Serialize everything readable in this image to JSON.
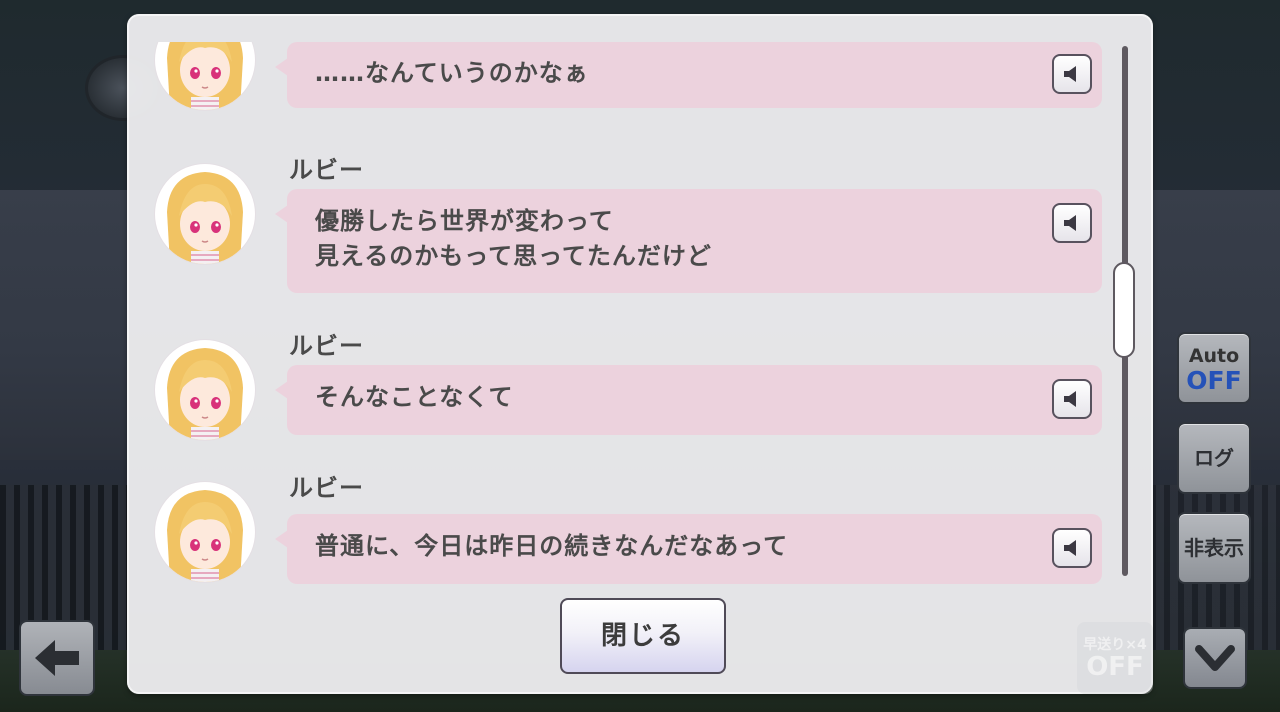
{
  "log": {
    "entries": [
      {
        "speaker": "",
        "text": "……なんていうのかなぁ"
      },
      {
        "speaker": "ルビー",
        "text": "優勝したら世界が変わって\n見えるのかもって思ってたんだけど"
      },
      {
        "speaker": "ルビー",
        "text": "そんなことなくて"
      },
      {
        "speaker": "ルビー",
        "text": "普通に、今日は昨日の続きなんだなあって"
      }
    ],
    "close_label": "閉じる",
    "voice_icon": "speaker-icon"
  },
  "controls": {
    "auto_label": "Auto",
    "auto_state": "OFF",
    "log_label": "ログ",
    "hide_label": "非表示",
    "fast_forward_label": "早送り×4",
    "fast_forward_state": "OFF",
    "down_icon": "chevron-down-icon",
    "back_icon": "back-arrow-icon"
  },
  "colors": {
    "bubble": "#ecd2dd",
    "panel": "#ececee",
    "accent_off": "#2552b8"
  }
}
